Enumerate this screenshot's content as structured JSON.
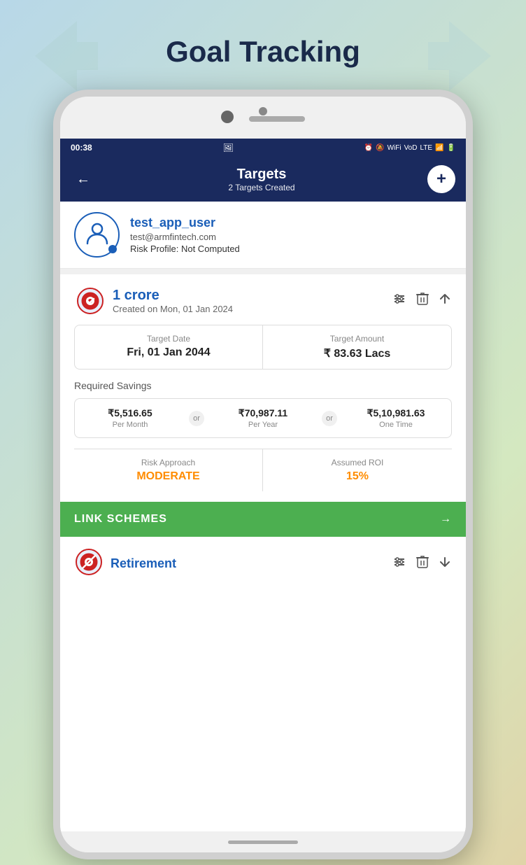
{
  "page": {
    "title": "Goal Tracking",
    "background_color": "#b8d8e8"
  },
  "status_bar": {
    "time": "00:38",
    "icons": [
      "📷",
      "🔕",
      "WiFi",
      "VoLTE",
      "Signal",
      "Battery"
    ]
  },
  "app_bar": {
    "title": "Targets",
    "subtitle": "2 Targets Created",
    "back_label": "←",
    "add_label": "+"
  },
  "user_profile": {
    "username": "test_app_user",
    "email": "test@armfintech.com",
    "risk_profile": "Risk Profile: Not Computed"
  },
  "goal_1": {
    "title": "1 crore",
    "created_date": "Created on Mon, 01 Jan 2024",
    "target_date_label": "Target Date",
    "target_date_value": "Fri, 01 Jan 2044",
    "target_amount_label": "Target Amount",
    "target_amount_value": "₹ 83.63 Lacs",
    "required_savings_label": "Required Savings",
    "per_month_amount": "₹5,516.65",
    "per_month_label": "Per Month",
    "per_year_amount": "₹70,987.11",
    "per_year_label": "Per Year",
    "one_time_amount": "₹5,10,981.63",
    "one_time_label": "One Time",
    "or_label": "or",
    "risk_approach_label": "Risk Approach",
    "risk_approach_value": "MODERATE",
    "assumed_roi_label": "Assumed ROI",
    "assumed_roi_value": "15%",
    "link_schemes_label": "LINK SCHEMES",
    "link_arrow": "→"
  },
  "goal_2": {
    "title": "Retirement",
    "action_icons": {
      "settings": "⊞",
      "delete": "🗑",
      "down": "↓"
    }
  },
  "icons": {
    "back": "←",
    "add": "+",
    "settings": "⊞",
    "delete": "🗑",
    "up": "↑",
    "down": "↓",
    "arrow_right": "→"
  }
}
